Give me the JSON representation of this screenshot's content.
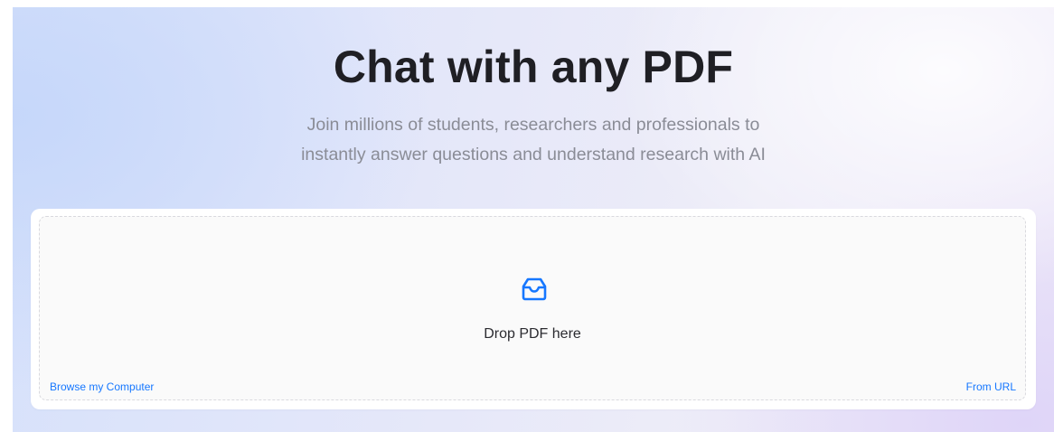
{
  "hero": {
    "title": "Chat with any PDF",
    "subtitle_line1": "Join millions of students, researchers and professionals to",
    "subtitle_line2": "instantly answer questions and understand research with AI"
  },
  "upload": {
    "icon": "inbox-icon",
    "drop_label": "Drop PDF here",
    "browse_label": "Browse my Computer",
    "url_label": "From URL"
  },
  "colors": {
    "accent": "#1677ff",
    "title": "#1f1f24",
    "subtitle": "#8a8c96"
  }
}
